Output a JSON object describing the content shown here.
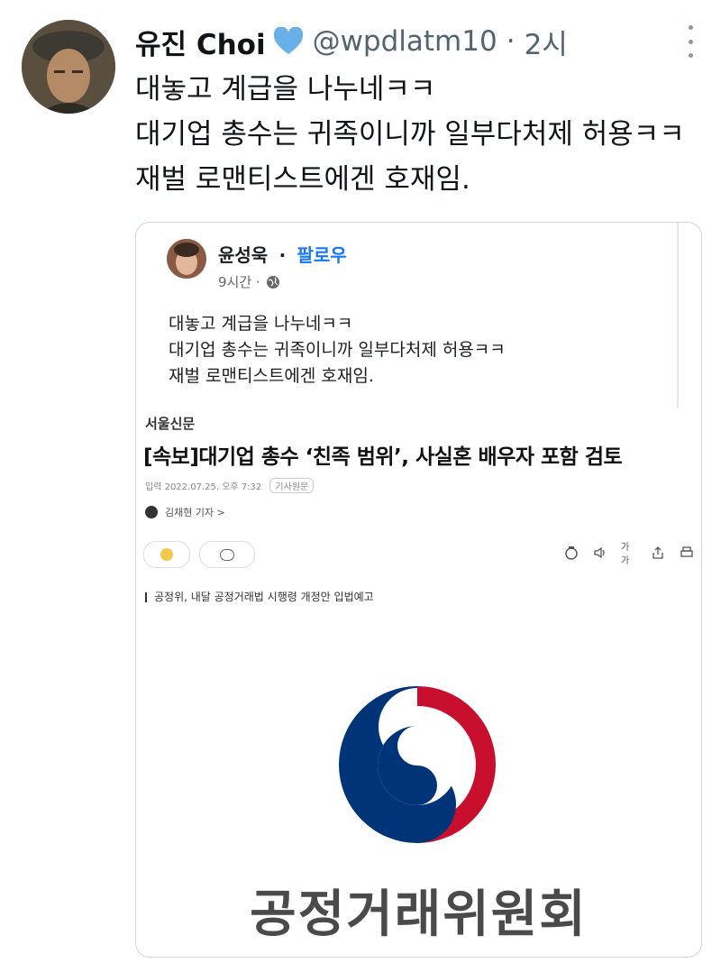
{
  "tweet": {
    "display_name": "유진 Choi",
    "handle": "@wpdlatm10",
    "separator": "·",
    "time": "2시",
    "verified_icon": "heart-verified-icon",
    "lines": [
      "대놓고 계급을 나누네ㅋㅋ",
      "대기업 총수는 귀족이니까 일부다처제 허용ㅋㅋ",
      "재벌 로맨티스트에겐 호재임."
    ]
  },
  "quoted_post": {
    "author": "윤성욱",
    "dot": "·",
    "follow_label": "팔로우",
    "time": "9시간 ·",
    "lines": [
      "대놓고 계급을 나누네ㅋㅋ",
      "대기업 총수는 귀족이니까 일부다처제 허용ㅋㅋ",
      "재벌 로맨티스트에겐 호재임."
    ]
  },
  "article": {
    "source": "서울신문",
    "headline": "[속보]대기업 총수 ‘친족 범위’, 사실혼 배우자 포함 검토",
    "date": "입력 2022.07.25. 오후 7:32",
    "date_tag": "기사원문",
    "reporter": "김채현 기자 >",
    "font_tool": "가가",
    "subheadline": "공정위, 내달 공정거래법 시행령 개정안 입법예고",
    "agency_name": "공정거래위원회"
  },
  "colors": {
    "accent_blue": "#1877f2",
    "verified": "#6ab0e8",
    "logo_red": "#c8102e",
    "logo_blue": "#003478"
  }
}
